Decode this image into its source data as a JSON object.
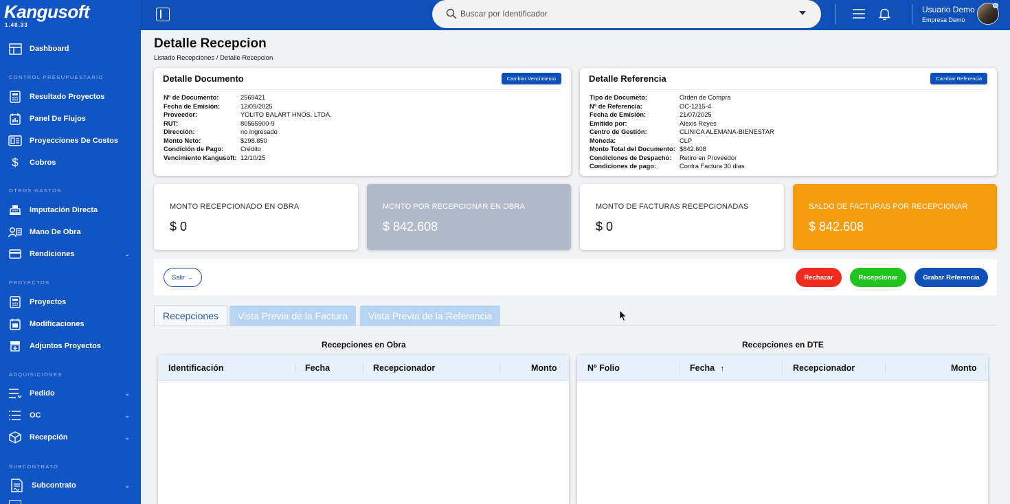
{
  "app": {
    "logo": "Kangusoft",
    "version": "1.48.33"
  },
  "sidebar": {
    "dashboard": "Dashboard",
    "sections": {
      "control": "CONTROL PRESUPUESTARIO",
      "otros": "OTROS GASTOS",
      "proyectos": "PROYECTOS",
      "adquisiciones": "ADQUISICIONES",
      "subcontrato": "SUBCONTRATO"
    },
    "items": {
      "resultado": "Resultado Proyectos",
      "flujos": "Panel De Flujos",
      "costos": "Proyecciones De Costos",
      "cobros": "Cobros",
      "imputacion": "Imputación Directa",
      "mano": "Mano De Obra",
      "rendiciones": "Rendiciones",
      "proyectos": "Proyectos",
      "modificaciones": "Modificaciones",
      "adjuntos": "Adjuntos Proyectos",
      "pedido": "Pedido",
      "oc": "OC",
      "recepcion": "Recepción",
      "subcontrato": "Subcontrato"
    }
  },
  "topbar": {
    "search_placeholder": "Buscar por Identificador",
    "user_name": "Usuario Demo",
    "user_company": "Empresa Demo"
  },
  "page": {
    "title": "Detalle Recepcion",
    "breadcrumb_parent": "Listado Recepciones",
    "breadcrumb_sep": "/",
    "breadcrumb_current": "Detalle Recepcion"
  },
  "documento": {
    "title": "Detalle Documento",
    "button": "Cambiar Vencimiento",
    "fields": [
      {
        "k": "Nº de Documento:",
        "v": "2569421"
      },
      {
        "k": "Fecha de Emisión:",
        "v": "12/09/2025"
      },
      {
        "k": "Proveedor:",
        "v": "YOLITO BALART HNOS. LTDA."
      },
      {
        "k": "RUT:",
        "v": "80565900-9"
      },
      {
        "k": "Dirección:",
        "v": "no ingresado"
      },
      {
        "k": "Monto Neto:",
        "v": "$298.850"
      },
      {
        "k": "Condición de Pago:",
        "v": "Crédito"
      },
      {
        "k": "Vencimiento Kangusoft:",
        "v": "12/10/25"
      }
    ]
  },
  "referencia": {
    "title": "Detalle Referencia",
    "button": "Cambiar Referencia",
    "fields": [
      {
        "k": "Tipo de Documeto:",
        "v": "Orden de Compra"
      },
      {
        "k": "Nº de Referencia:",
        "v": "OC-1215-4"
      },
      {
        "k": "Fecha de Emisión:",
        "v": "21/07/2025"
      },
      {
        "k": "Emitido por:",
        "v": "Alexis Reyes"
      },
      {
        "k": "Centro de Gestión:",
        "v": "CLINICA ALEMANA-BIENESTAR"
      },
      {
        "k": "Moneda:",
        "v": "CLP"
      },
      {
        "k": "Monto Total del Documento:",
        "v": "$842.608"
      },
      {
        "k": "Condiciones de Despacho:",
        "v": "Retiro en Proveedor"
      },
      {
        "k": "Condiciones de pago:",
        "v": "Contra Factura 30 dias"
      }
    ]
  },
  "stats": [
    {
      "title": "MONTO RECEPCIONADO EN OBRA",
      "value": "$ 0"
    },
    {
      "title": "MONTO POR RECEPCIONAR EN OBRA",
      "value": "$ 842.608"
    },
    {
      "title": "MONTO DE FACTURAS RECEPCIONADAS",
      "value": "$ 0"
    },
    {
      "title": "SALDO DE FACTURAS POR RECEPCIONAR",
      "value": "$ 842.608"
    }
  ],
  "actions": {
    "salir": "Salir",
    "rechazar": "Rechazar",
    "recepcionar": "Recepcionar",
    "grabar": "Grabar Referencia"
  },
  "tabs": [
    "Recepciones",
    "Vista Previa de la Factura",
    "Vista Previa de la Referencia"
  ],
  "grids": {
    "obra": {
      "title": "Recepciones en Obra",
      "columns": [
        "Identificación",
        "Fecha",
        "Recepcionador",
        "Monto"
      ]
    },
    "dte": {
      "title": "Recepciones en DTE",
      "columns": [
        "Nº Folio",
        "Fecha",
        "Recepcionador",
        "Monto"
      ]
    }
  },
  "colors": {
    "sidebar": "#1155c4",
    "topbar": "#0e4fb8",
    "stat_gray": "#b0bac8",
    "stat_orange": "#f59c0f",
    "red": "#f22b1f",
    "green": "#1fc41c",
    "blue": "#0e4fb8"
  }
}
